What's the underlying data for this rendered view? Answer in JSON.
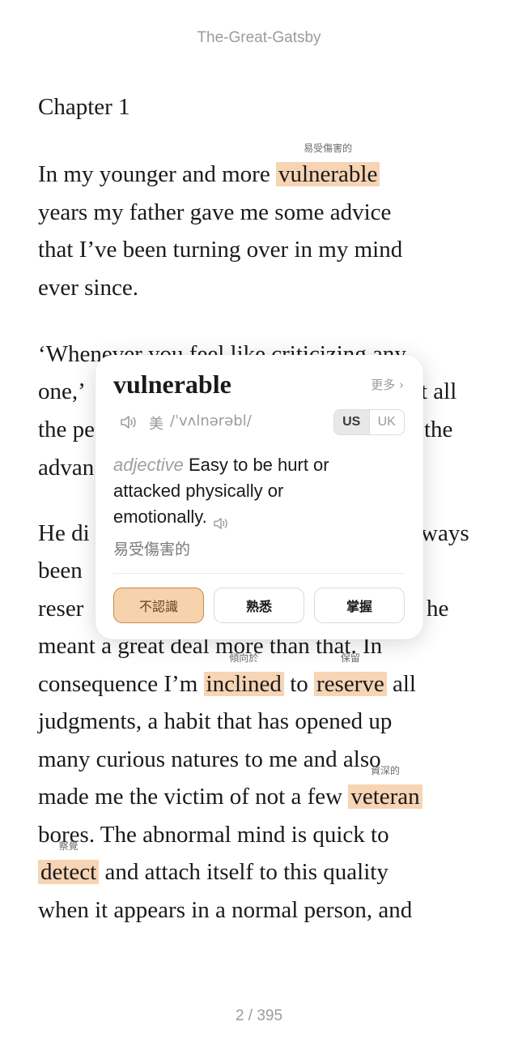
{
  "book": {
    "title": "The-Great-Gatsby"
  },
  "chapter": {
    "title": "Chapter 1"
  },
  "text_lines": {
    "l1_a": "In my younger and more ",
    "l1_word": "vulnerable",
    "l1_gloss": "易受傷害的",
    "l2": "years my father gave me some advice",
    "l3": "that I’ve been turning over in my mind",
    "l4": "ever since.",
    "l5": "‘Whenever you feel like criticizing any",
    "l6_a": "one,’",
    "l6_b": "t all",
    "l7_a": "the pe",
    "l7_b": "the",
    "l8_a": "advan",
    "l9_a": "He di",
    "l9_b": "ways",
    "l10_a": "been",
    "l11_a": "reser",
    "l11_b": "he",
    "l12": "meant a great deal more than that. In",
    "l13_a": "consequence I’m ",
    "l13_word1": "inclined",
    "l13_gloss1": "傾向於",
    "l13_b": " to ",
    "l13_word2": "reserve",
    "l13_gloss2": "保留",
    "l13_c": " all",
    "l14": "judgments, a habit that has opened up",
    "l15": "many curious natures to me and also",
    "l16_a": "made me the victim of not a few ",
    "l16_word": "veteran",
    "l16_gloss": "資深的",
    "l17": "bores. The abnormal mind is quick to",
    "l18_word": "detect",
    "l18_gloss": "察覺",
    "l18_b": " and attach itself to this quality",
    "l19": "when it appears in a normal person, and"
  },
  "popup": {
    "word": "vulnerable",
    "more_label": "更多 ›",
    "region_label": "美",
    "phonetic": "/ˈvʌlnərəbl/",
    "accent_options": [
      "US",
      "UK"
    ],
    "selected_accent": "US",
    "part_of_speech": "adjective",
    "definition": " Easy to be hurt or attacked physically or emotionally.",
    "translation": "易受傷害的",
    "buttons": {
      "unknown": "不認識",
      "familiar": "熟悉",
      "mastered": "掌握"
    },
    "icons": [
      "speaker-icon"
    ]
  },
  "footer": {
    "page_indicator": "2 / 395"
  },
  "colors": {
    "highlight": "#f6d4b4",
    "button_selected": "#f6d2ad",
    "button_selected_border": "#c9874a"
  }
}
